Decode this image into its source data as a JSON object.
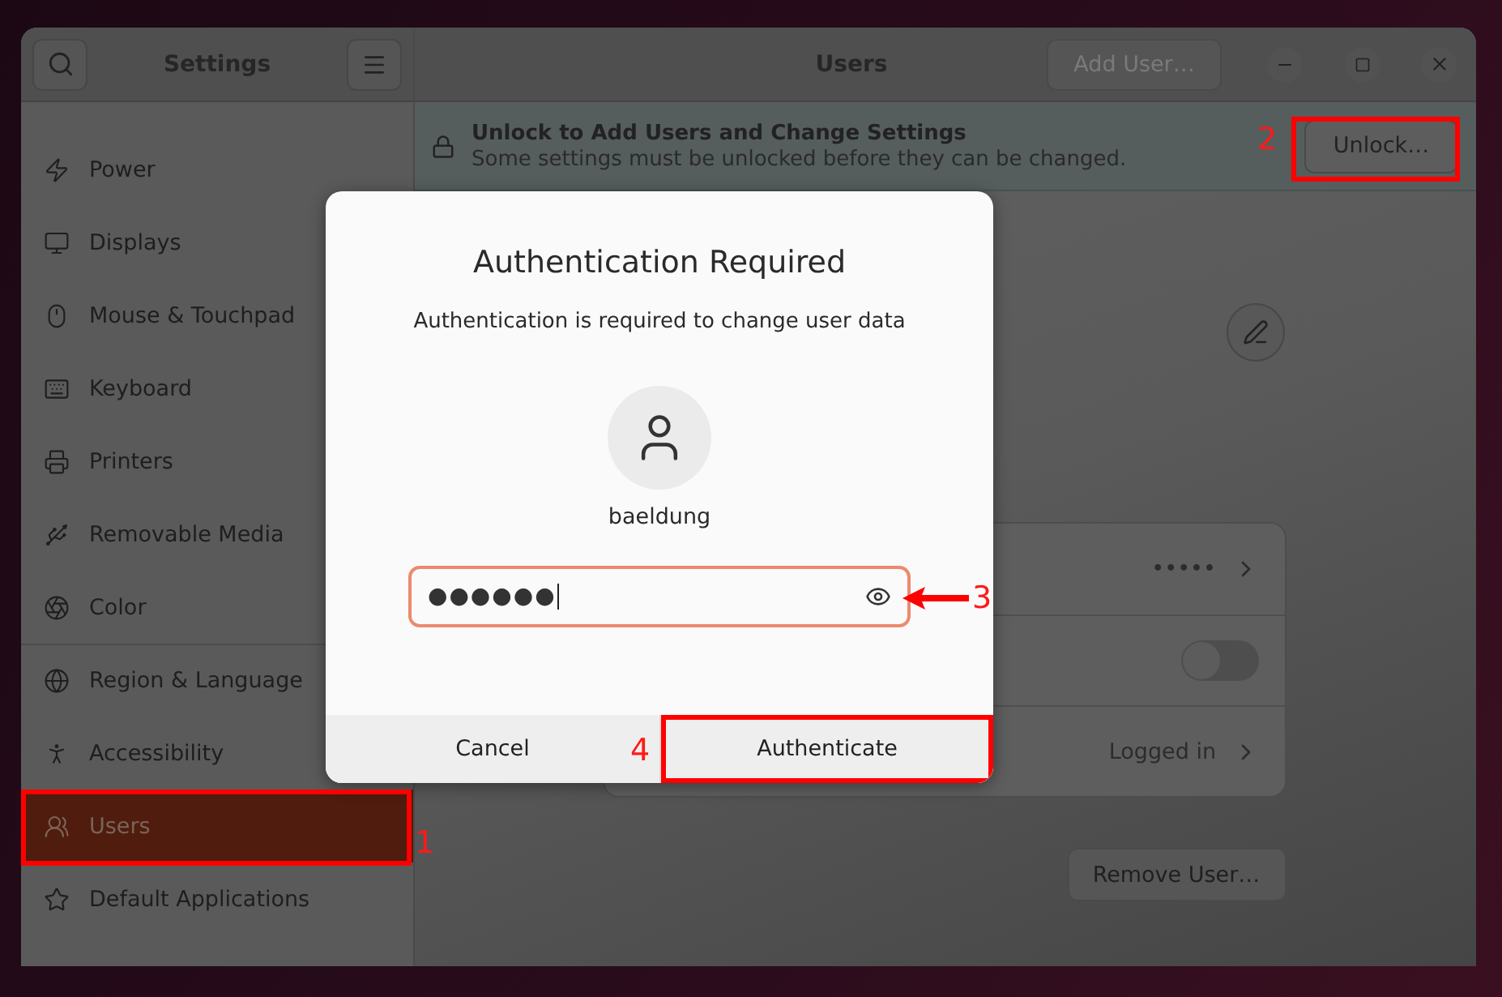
{
  "header": {
    "sidebar_title": "Settings",
    "title": "Users",
    "add_user_button": "Add User…"
  },
  "sidebar": {
    "items": [
      {
        "label": "Power",
        "selected": false
      },
      {
        "label": "Displays",
        "selected": false
      },
      {
        "label": "Mouse & Touchpad",
        "selected": false
      },
      {
        "label": "Keyboard",
        "selected": false
      },
      {
        "label": "Printers",
        "selected": false
      },
      {
        "label": "Removable Media",
        "selected": false
      },
      {
        "label": "Color",
        "selected": false
      },
      {
        "label": "Region & Language",
        "selected": false
      },
      {
        "label": "Accessibility",
        "selected": false
      },
      {
        "label": "Users",
        "selected": true
      },
      {
        "label": "Default Applications",
        "selected": false
      }
    ]
  },
  "banner": {
    "title": "Unlock to Add Users and Change Settings",
    "subtitle": "Some settings must be unlocked before they can be changed.",
    "button": "Unlock…"
  },
  "user_rows": [
    {
      "kind": "value",
      "value": "•••••"
    },
    {
      "kind": "switch",
      "on": false
    },
    {
      "kind": "value",
      "value": "Logged in"
    }
  ],
  "remove_button": "Remove User…",
  "dialog": {
    "title": "Authentication Required",
    "message": "Authentication is required to change user data",
    "username": "baeldung",
    "password": "●●●●●●",
    "buttons": [
      "Cancel",
      "Authenticate"
    ]
  },
  "annotations": [
    {
      "kind": "box",
      "number": "1"
    },
    {
      "kind": "box",
      "number": "2"
    },
    {
      "kind": "arrow",
      "number": "3"
    },
    {
      "kind": "box",
      "number": "4"
    }
  ]
}
